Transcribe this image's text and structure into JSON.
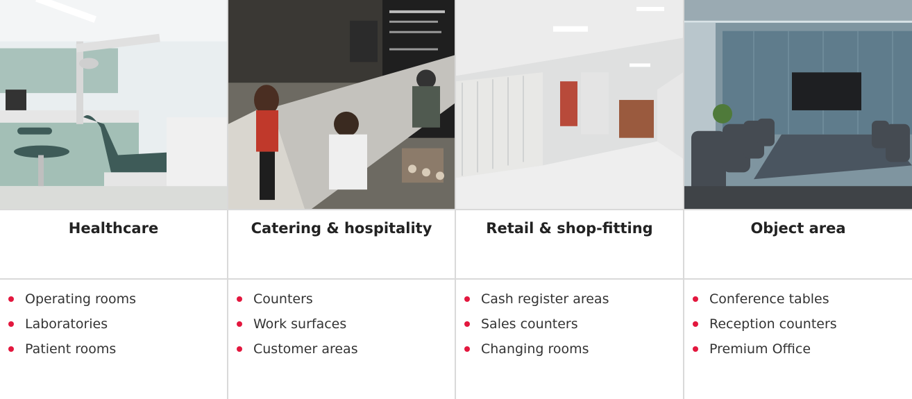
{
  "columns": [
    {
      "title": "Healthcare",
      "photo_icon": "dental-treatment-room-photo",
      "items": [
        "Operating rooms",
        "Laboratories",
        "Patient rooms"
      ]
    },
    {
      "title": "Catering & hospitality",
      "photo_icon": "cafe-counter-photo",
      "items": [
        "Counters",
        "Work surfaces",
        "Customer areas"
      ]
    },
    {
      "title": "Retail & shop-fitting",
      "photo_icon": "locker-room-corridor-photo",
      "items": [
        "Cash register areas",
        "Sales counters",
        "Changing rooms"
      ]
    },
    {
      "title": "Object area",
      "photo_icon": "conference-room-photo",
      "items": [
        "Conference tables",
        "Reception counters",
        "Premium Office"
      ]
    }
  ],
  "colors": {
    "bullet": "#e3173e",
    "divider": "#d9d9d9",
    "title": "#222222",
    "text": "#333333"
  }
}
